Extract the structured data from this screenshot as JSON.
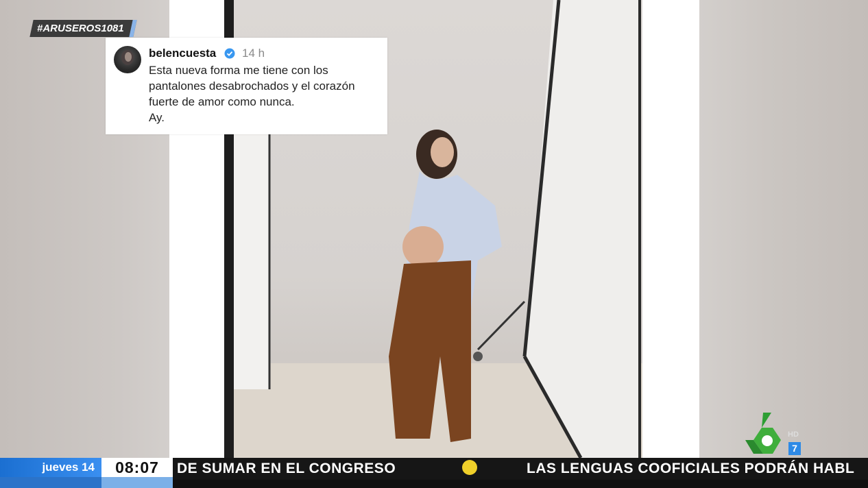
{
  "hashtag": "#ARUSEROS1081",
  "post": {
    "username": "belencuesta",
    "time": "14 h",
    "text": "Esta nueva forma me tiene con los\npantalones desabrochados y el corazón\nfuerte de amor como nunca.\nAy."
  },
  "channel": {
    "hd_label": "HD",
    "number": "7"
  },
  "ticker": {
    "day": "jueves 14",
    "time": "08:07",
    "headline_1": "DE SUMAR EN EL CONGRESO",
    "headline_2": "LAS LENGUAS COOFICIALES PODRÁN HABL"
  },
  "colors": {
    "accent_blue": "#2e8ae6",
    "logo_green": "#3fae3c",
    "ticker_dot": "#f0d02a",
    "verified": "#3897f0"
  }
}
